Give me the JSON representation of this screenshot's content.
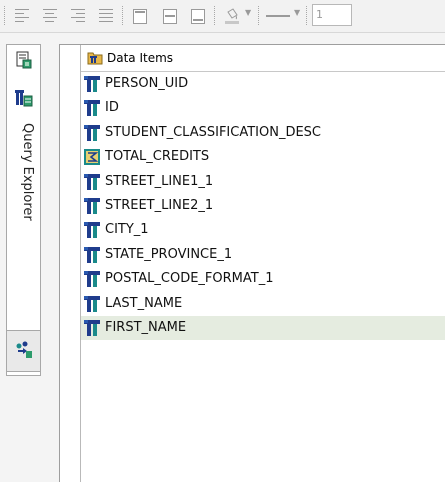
{
  "toolbar": {
    "font_size_value": "1",
    "buttons": [
      {
        "name": "align-left-button",
        "icon": "align-left-icon"
      },
      {
        "name": "align-center-button",
        "icon": "align-center-icon"
      },
      {
        "name": "align-right-button",
        "icon": "align-right-icon"
      },
      {
        "name": "justify-button",
        "icon": "justify-icon"
      },
      {
        "name": "align-top-button",
        "icon": "align-top-icon"
      },
      {
        "name": "align-middle-button",
        "icon": "align-middle-icon"
      },
      {
        "name": "align-bottom-button",
        "icon": "align-bottom-icon"
      },
      {
        "name": "fill-color-button",
        "icon": "paint-bucket-icon"
      },
      {
        "name": "line-style-button",
        "icon": "line-style-icon"
      }
    ]
  },
  "sidebar": {
    "tab_label": "Query Explorer",
    "icons": [
      "report-page-icon",
      "query-data-icon",
      "query-join-icon"
    ]
  },
  "tree": {
    "header": "Data Items",
    "items": [
      {
        "label": "PERSON_UID",
        "kind": "data-item"
      },
      {
        "label": "ID",
        "kind": "data-item"
      },
      {
        "label": "STUDENT_CLASSIFICATION_DESC",
        "kind": "data-item"
      },
      {
        "label": "TOTAL_CREDITS",
        "kind": "calculated-item"
      },
      {
        "label": "STREET_LINE1_1",
        "kind": "data-item"
      },
      {
        "label": "STREET_LINE2_1",
        "kind": "data-item"
      },
      {
        "label": "CITY_1",
        "kind": "data-item"
      },
      {
        "label": "STATE_PROVINCE_1",
        "kind": "data-item"
      },
      {
        "label": "POSTAL_CODE_FORMAT_1",
        "kind": "data-item"
      },
      {
        "label": "LAST_NAME",
        "kind": "data-item"
      },
      {
        "label": "FIRST_NAME",
        "kind": "data-item",
        "selected": true
      }
    ]
  },
  "colors": {
    "selected_row": "#e5ece0",
    "item_icon_blue": "#1f3c8c",
    "item_icon_teal": "#1a8a8a"
  }
}
